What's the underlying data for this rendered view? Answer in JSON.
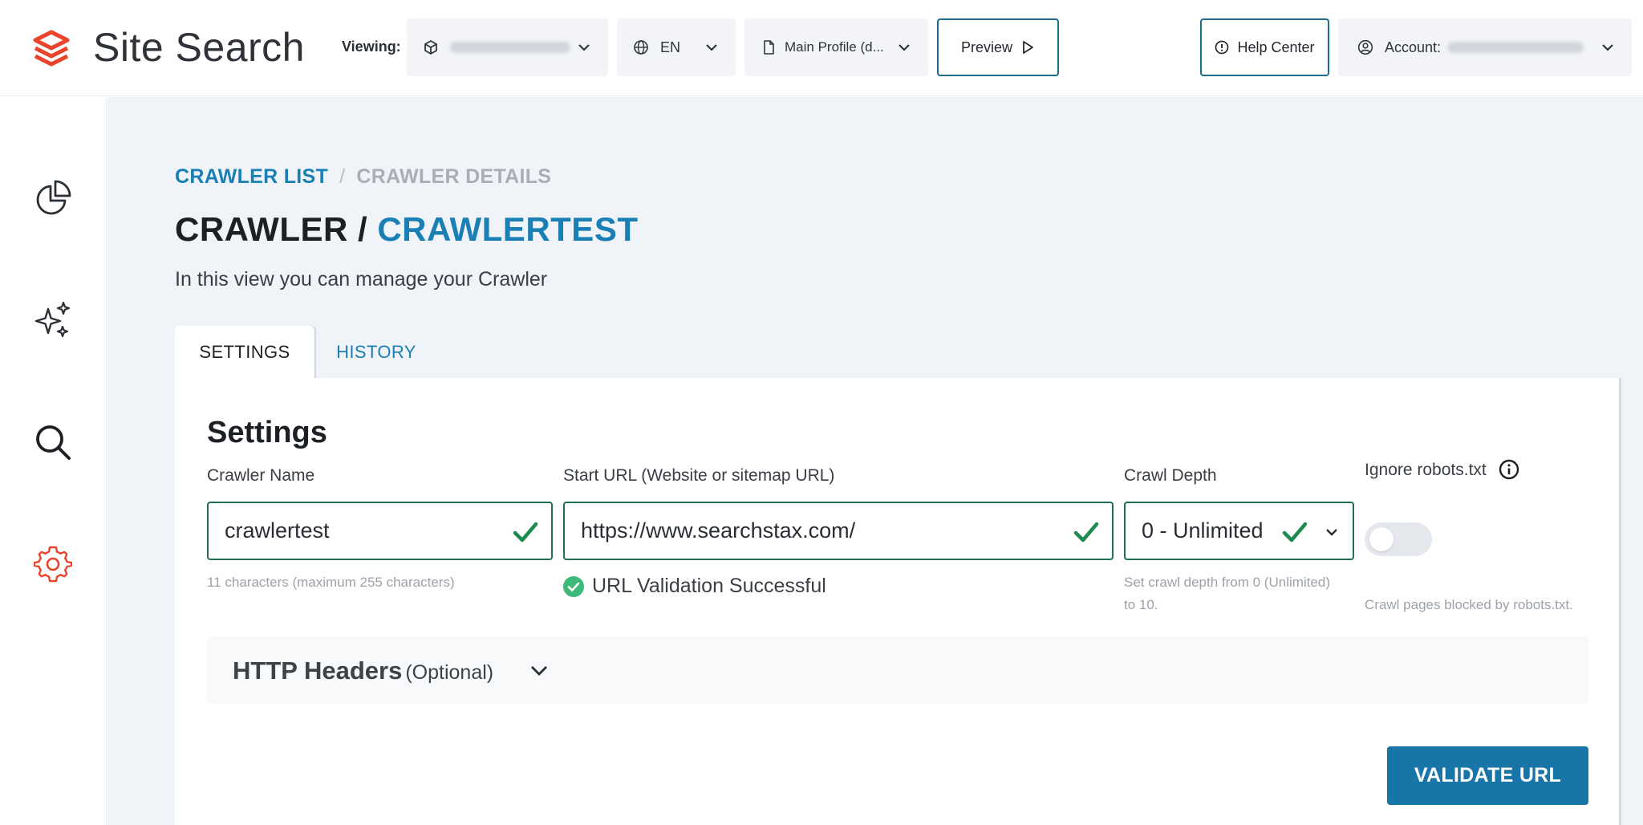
{
  "app": {
    "title": "Site Search",
    "brand_color": "#e8452c",
    "accent_color": "#1a7fb5"
  },
  "header": {
    "viewing_label": "Viewing:",
    "app_select": {
      "icon": "cube-icon"
    },
    "language_select": {
      "value": "EN",
      "icon": "globe-icon"
    },
    "profile_select": {
      "value": "Main Profile (d...",
      "icon": "file-icon"
    },
    "preview_label": "Preview",
    "help_label": "Help Center",
    "account_label": "Account:"
  },
  "sidebar": {
    "items": [
      {
        "name": "analytics",
        "icon": "pie-chart-icon"
      },
      {
        "name": "ai",
        "icon": "sparkles-icon"
      },
      {
        "name": "search",
        "icon": "search-icon"
      },
      {
        "name": "settings",
        "icon": "gear-icon",
        "active": true
      }
    ]
  },
  "breadcrumb": {
    "link": "CRAWLER LIST",
    "separator": "/",
    "current": "CRAWLER DETAILS"
  },
  "page": {
    "title_prefix": "CRAWLER /",
    "title_accent": "CRAWLERTEST",
    "subtitle": "In this view you can manage your Crawler"
  },
  "tabs": [
    {
      "label": "SETTINGS",
      "active": true
    },
    {
      "label": "HISTORY",
      "active": false
    }
  ],
  "settings": {
    "title": "Settings",
    "crawler_name": {
      "label": "Crawler Name",
      "value": "crawlertest",
      "hint": "11 characters (maximum 255 characters)"
    },
    "start_url": {
      "label": "Start URL (Website or sitemap URL)",
      "value": "https://www.searchstax.com/",
      "validation": "URL Validation Successful"
    },
    "crawl_depth": {
      "label": "Crawl Depth",
      "value": "0 - Unlimited",
      "hint_line1": "Set crawl depth from 0 (Unlimited)",
      "hint_line2": "to 10."
    },
    "ignore_robots": {
      "label": "Ignore robots.txt",
      "enabled": false,
      "hint": "Crawl pages blocked by robots.txt."
    },
    "http_headers": {
      "title": "HTTP Headers",
      "optional": "(Optional)"
    },
    "validate_button": "VALIDATE URL"
  }
}
